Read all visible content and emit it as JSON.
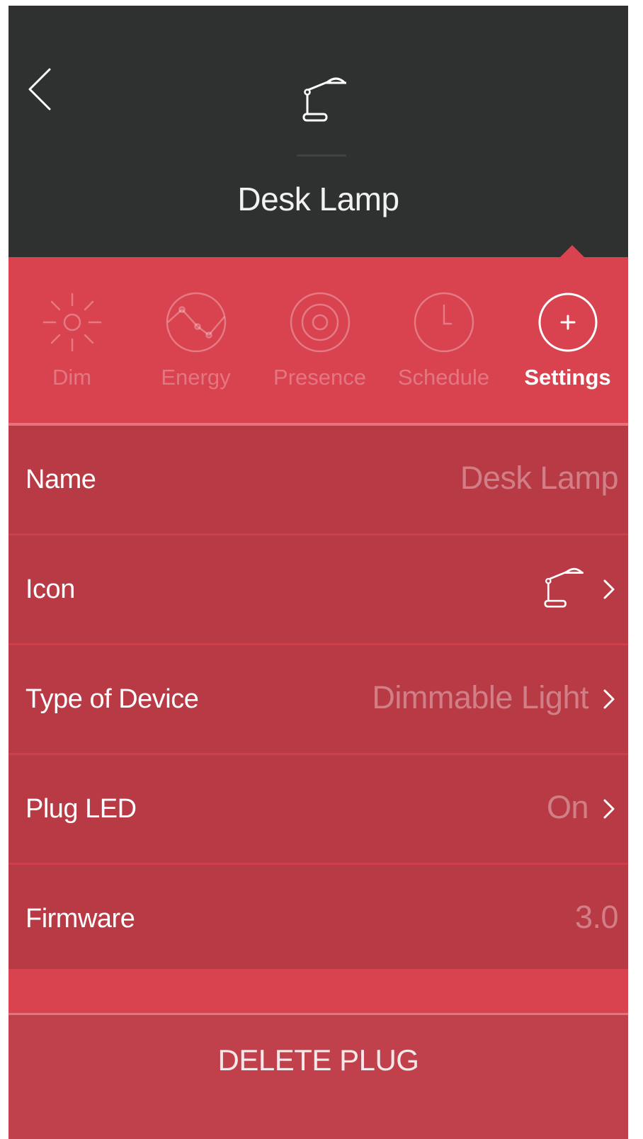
{
  "header": {
    "title": "Desk Lamp",
    "back_icon": "chevron-left-icon",
    "device_icon": "desk-lamp-icon"
  },
  "tabs": [
    {
      "label": "Dim",
      "icon": "sun-icon",
      "active": false
    },
    {
      "label": "Energy",
      "icon": "energy-graph-icon",
      "active": false
    },
    {
      "label": "Presence",
      "icon": "presence-target-icon",
      "active": false
    },
    {
      "label": "Schedule",
      "icon": "clock-icon",
      "active": false
    },
    {
      "label": "Settings",
      "icon": "plus-circle-icon",
      "active": true
    }
  ],
  "settings": {
    "name_label": "Name",
    "name_value": "Desk Lamp",
    "icon_label": "Icon",
    "icon_value": "desk-lamp-icon",
    "type_label": "Type of Device",
    "type_value": "Dimmable Light",
    "led_label": "Plug LED",
    "led_value": "On",
    "firmware_label": "Firmware",
    "firmware_value": "3.0"
  },
  "delete_label": "DELETE PLUG",
  "colors": {
    "header_bg": "#2f3131",
    "tab_bar_bg": "#d9424f",
    "list_bg": "#b83a45",
    "delete_bg": "#c0404b"
  }
}
